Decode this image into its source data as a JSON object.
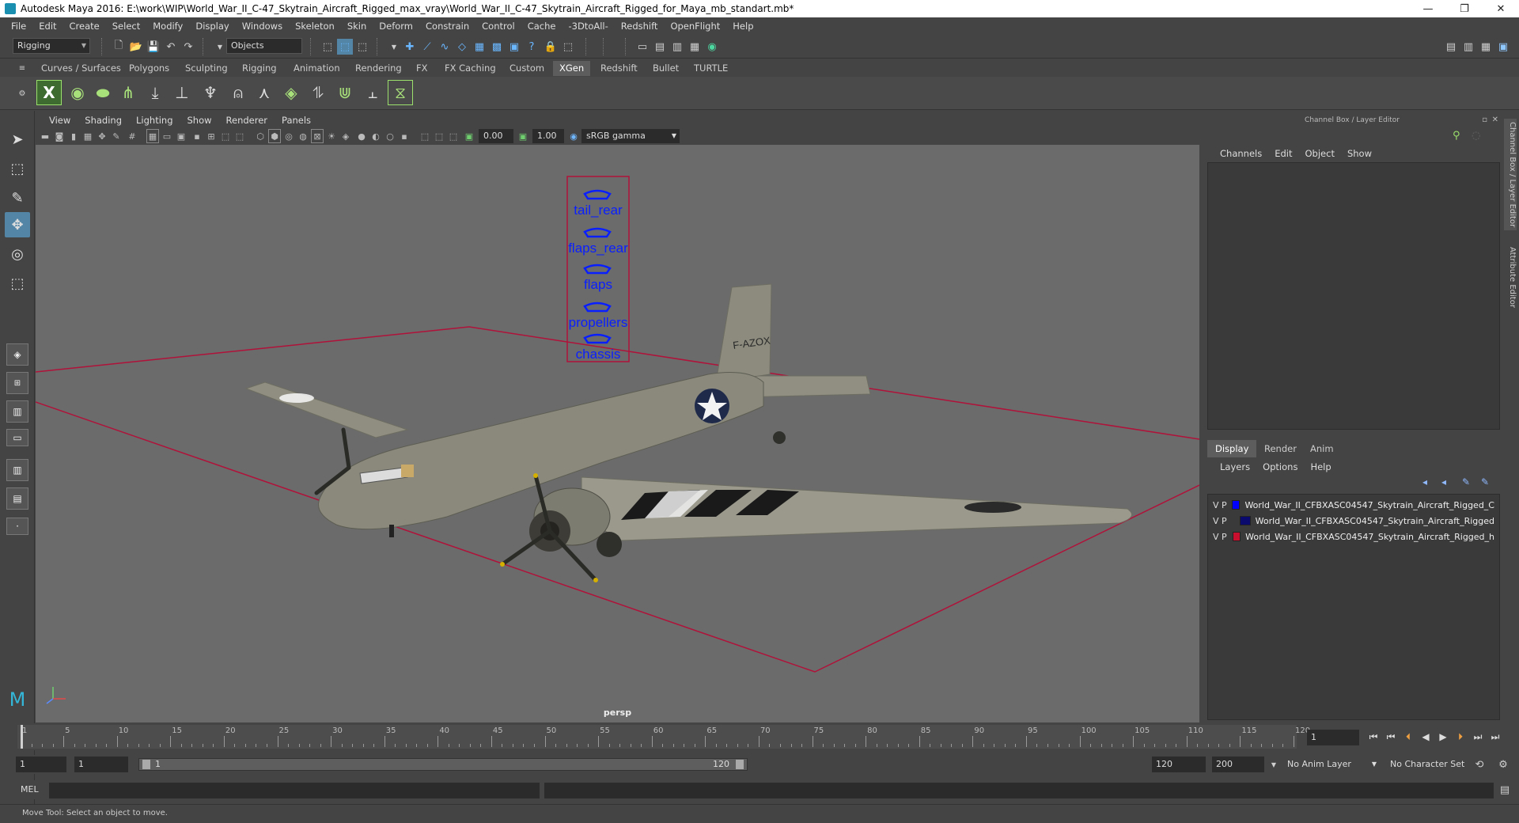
{
  "window": {
    "title": "Autodesk Maya 2016: E:\\work\\WIP\\World_War_II_C-47_Skytrain_Aircraft_Rigged_max_vray\\World_War_II_C-47_Skytrain_Aircraft_Rigged_for_Maya_mb_standart.mb*",
    "minimize": "—",
    "restore": "❐",
    "close": "✕"
  },
  "menus": [
    "File",
    "Edit",
    "Create",
    "Select",
    "Modify",
    "Display",
    "Windows",
    "Skeleton",
    "Skin",
    "Deform",
    "Constrain",
    "Control",
    "Cache",
    "-3DtoAll-",
    "Redshift",
    "OpenFlight",
    "Help"
  ],
  "statusline": {
    "mode": "Rigging",
    "select_mode": "Objects"
  },
  "shelf": {
    "tabs": [
      "Curves / Surfaces",
      "Polygons",
      "Sculpting",
      "Rigging",
      "Animation",
      "Rendering",
      "FX",
      "FX Caching",
      "Custom",
      "XGen",
      "Redshift",
      "Bullet",
      "TURTLE"
    ],
    "active": "XGen"
  },
  "panel": {
    "menus": [
      "View",
      "Shading",
      "Lighting",
      "Show",
      "Renderer",
      "Panels"
    ],
    "exposure": "0.00",
    "gamma": "1.00",
    "colorspace": "sRGB gamma",
    "camera": "persp"
  },
  "controls": [
    "tail_rear",
    "flaps_rear",
    "flaps",
    "propellers",
    "chassis"
  ],
  "aircraft": {
    "tail_code": "F-AZOX"
  },
  "channel_box": {
    "header": "Channel Box / Layer Editor",
    "menus": [
      "Channels",
      "Edit",
      "Object",
      "Show"
    ]
  },
  "layer_editor": {
    "tabs": [
      "Display",
      "Render",
      "Anim"
    ],
    "active": "Display",
    "menus": [
      "Layers",
      "Options",
      "Help"
    ],
    "layers": [
      {
        "v": "V",
        "p": "P",
        "color": "#0000ff",
        "name": "World_War_II_CFBXASC04547_Skytrain_Aircraft_Rigged_C"
      },
      {
        "v": "V",
        "p": "P",
        "color": "#0a0a6e",
        "name": "World_War_II_CFBXASC04547_Skytrain_Aircraft_Rigged"
      },
      {
        "v": "V",
        "p": "P",
        "color": "#c8102e",
        "name": "World_War_II_CFBXASC04547_Skytrain_Aircraft_Rigged_h"
      }
    ]
  },
  "side_tabs": [
    "Channel Box / Layer Editor",
    "Attribute Editor"
  ],
  "timeline": {
    "ticks": [
      1,
      5,
      10,
      15,
      20,
      25,
      30,
      35,
      40,
      45,
      50,
      55,
      60,
      65,
      70,
      75,
      80,
      85,
      90,
      95,
      100,
      105,
      110,
      115,
      120
    ],
    "current_frame": "1",
    "min": 1,
    "max": 120
  },
  "range": {
    "start": "1",
    "playback_start": "1",
    "slider_start": "1",
    "slider_end": "120",
    "playback_end": "120",
    "end": "200",
    "anim_layer": "No Anim Layer",
    "character_set": "No Character Set"
  },
  "cmd": {
    "lang": "MEL"
  },
  "help": "Move Tool: Select an object to move."
}
